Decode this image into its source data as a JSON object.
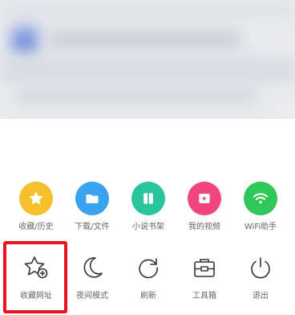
{
  "quick_access": [
    {
      "label": "收藏/历史",
      "icon": "star-icon",
      "color": "#f5c02c"
    },
    {
      "label": "下载/文件",
      "icon": "folder-icon",
      "color": "#3aa3f0"
    },
    {
      "label": "小说书架",
      "icon": "book-icon",
      "color": "#28c49b"
    },
    {
      "label": "我的视频",
      "icon": "play-icon",
      "color": "#f0457f"
    },
    {
      "label": "WiFi助手",
      "icon": "wifi-icon",
      "color": "#2fc65a"
    }
  ],
  "tools": [
    {
      "label": "收藏网址",
      "icon": "star-add-icon"
    },
    {
      "label": "夜间模式",
      "icon": "moon-icon"
    },
    {
      "label": "刷新",
      "icon": "refresh-icon"
    },
    {
      "label": "工具箱",
      "icon": "toolbox-icon"
    },
    {
      "label": "退出",
      "icon": "power-icon"
    }
  ],
  "highlight_color": "#e5161d"
}
